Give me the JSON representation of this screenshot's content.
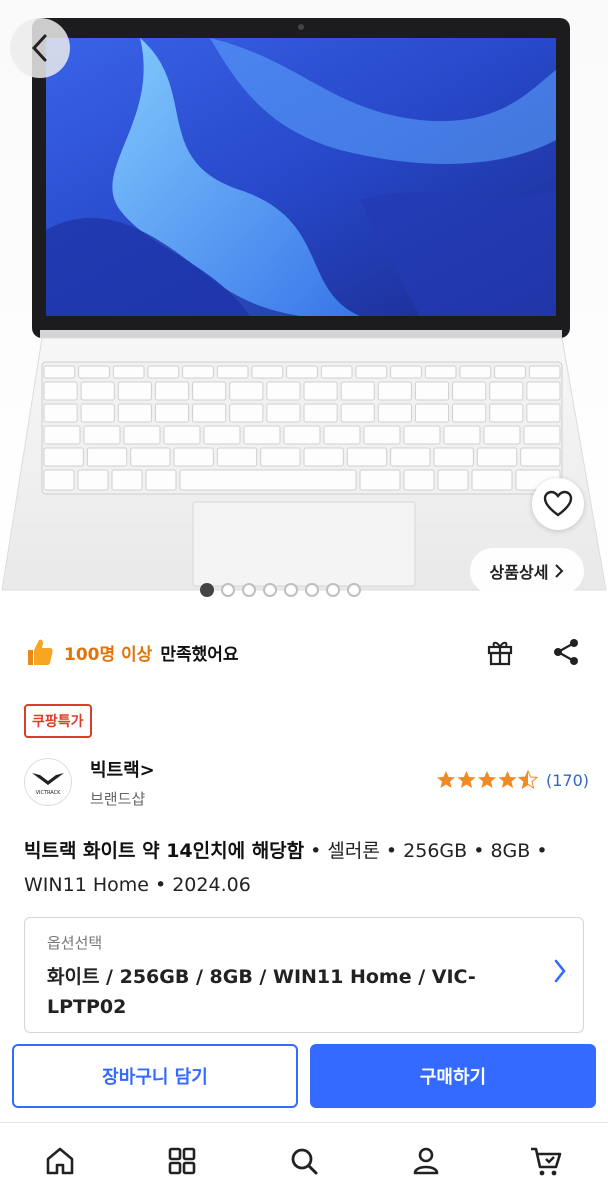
{
  "hero": {
    "detail_label": "상품상세",
    "image_count": 8,
    "active_index": 0
  },
  "satisfaction": {
    "highlight": "100명 이상",
    "rest": "만족했어요"
  },
  "badge": {
    "label": "쿠팡특가"
  },
  "brand": {
    "name": "빅트랙>",
    "sub": "브랜드샵",
    "logo_text": "VICTRACK"
  },
  "rating": {
    "stars": 4.5,
    "count": "(170)"
  },
  "product": {
    "title_bold": "빅트랙 화이트 약 14인치에 해당함",
    "title_rest": " • 셀러론 • 256GB • 8GB • WIN11 Home • 2024.06"
  },
  "option": {
    "label": "옵션선택",
    "value": "화이트 / 256GB / 8GB / WIN11 Home / VIC-LPTP02"
  },
  "actions": {
    "cart_label": "장바구니 담기",
    "buy_label": "구매하기"
  },
  "nav": {
    "items": [
      "home-icon",
      "categories-icon",
      "search-icon",
      "account-icon",
      "cart-icon"
    ]
  },
  "colors": {
    "accent": "#346aff",
    "highlight": "#e0740a",
    "badge": "#d8402a",
    "star": "#f08a24"
  }
}
